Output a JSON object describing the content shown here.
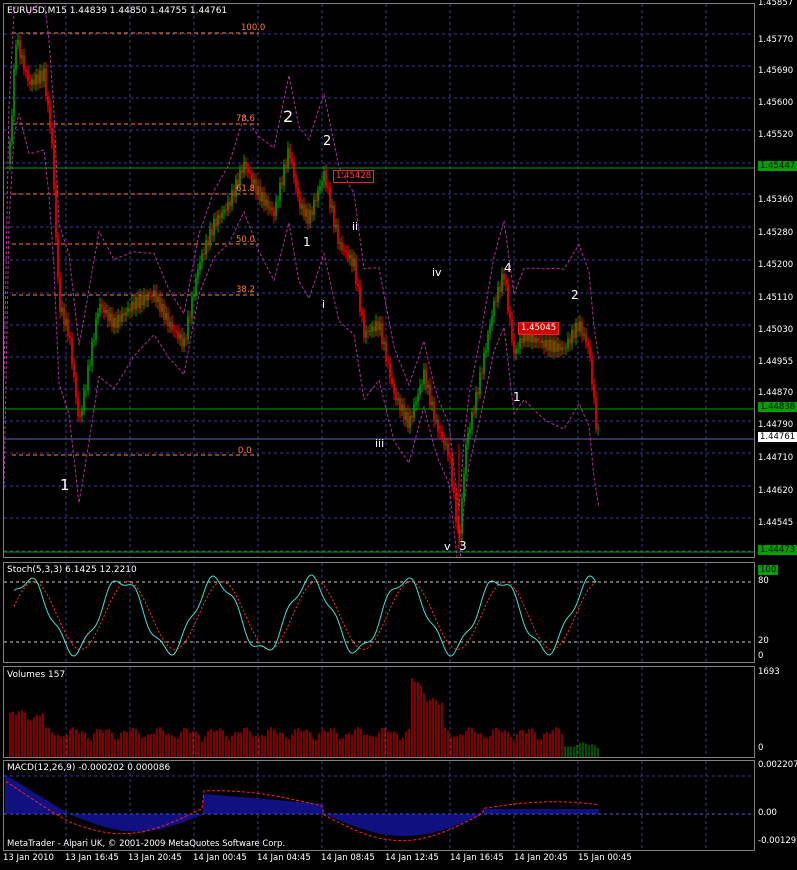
{
  "main": {
    "title": "EURUSD,M15  1.44839 1.44850 1.44755 1.44761",
    "price_ticks": [
      "1.45857",
      "1.45770",
      "1.45690",
      "1.45600",
      "1.45520",
      "1.45447",
      "1.45360",
      "1.45280",
      "1.45200",
      "1.45110",
      "1.45030",
      "1.44955",
      "1.44870",
      "1.44838",
      "1.44790",
      "1.44761",
      "1.44710",
      "1.44620",
      "1.44545",
      "1.44473"
    ],
    "fib_labels": [
      "100.0",
      "78.6",
      "61.8",
      "50.0",
      "38.2",
      "0.0"
    ],
    "price_boxes": [
      "1.45428",
      "1.45045"
    ],
    "waves": [
      "1",
      "2",
      "2",
      "1",
      "ii",
      "i",
      "iii",
      "iv",
      "v",
      "3",
      "4",
      "1",
      "2"
    ]
  },
  "stoch": {
    "title": "Stoch(5,3,3) 6.1425 12.2210",
    "ticks": [
      "100",
      "80",
      "20",
      "0"
    ]
  },
  "volumes": {
    "title": "Volumes 157",
    "ticks": [
      "1693",
      "0"
    ]
  },
  "macd": {
    "title": "MACD(12,26,9) -0.000202 0.000086",
    "ticks": [
      "0.002207",
      "0.00",
      "-0.00129"
    ]
  },
  "copyright": "MetaTrader - Alpari UK, © 2001-2009 MetaQuotes Software Corp.",
  "time_labels": [
    "13 Jan 2010",
    "13 Jan 16:45",
    "13 Jan 20:45",
    "14 Jan 00:45",
    "14 Jan 04:45",
    "14 Jan 08:45",
    "14 Jan 12:45",
    "14 Jan 16:45",
    "14 Jan 20:45",
    "15 Jan 00:45"
  ],
  "colors": {
    "bull": "#00a000",
    "bear": "#ff0000",
    "stoch_main": "#40e0d0",
    "stoch_signal": "#ff3030",
    "macd_hist": "#2020ff",
    "macd_signal": "#ff2020",
    "grid": "#3a3a90",
    "fib": "#ff7f27",
    "bands": "#b0309a"
  }
}
